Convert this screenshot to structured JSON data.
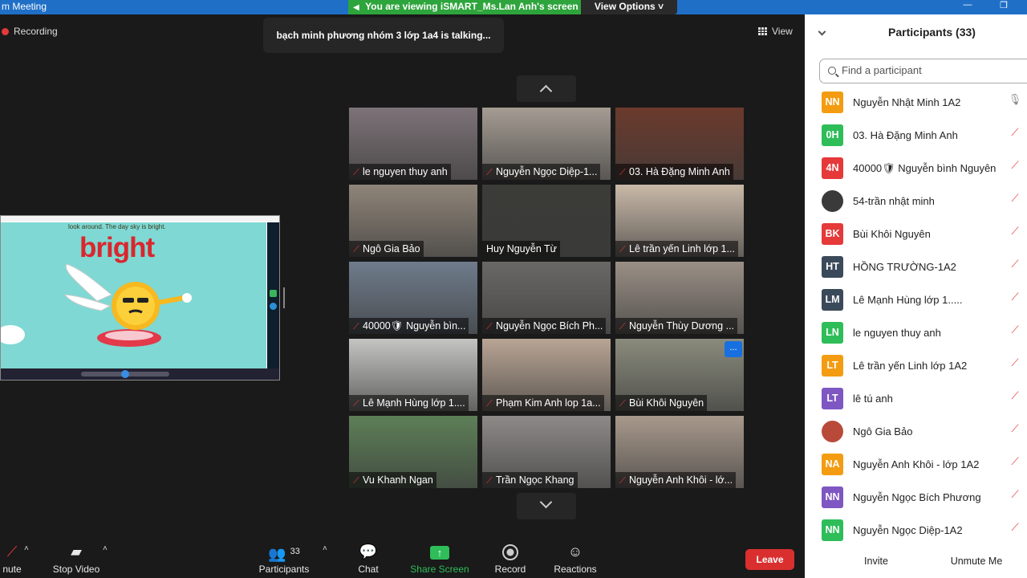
{
  "titlebar": {
    "title": "m Meeting",
    "viewing": "You are viewing iSMART_Ms.Lan Anh's screen",
    "view_options": "View Options"
  },
  "main": {
    "recording": "Recording",
    "talking": "bạch minh phương  nhóm 3 lớp 1a4 is talking...",
    "view_label": "View"
  },
  "share": {
    "caption": "look around. The day sky is bright.",
    "word": "bright"
  },
  "tiles": [
    {
      "name": "le nguyen thuy anh",
      "muted": true,
      "bg": "#7d7378"
    },
    {
      "name": "Nguyễn Ngọc Diệp-1...",
      "muted": true,
      "bg": "#a59c93"
    },
    {
      "name": "03. Hà Đặng Minh Anh",
      "muted": true,
      "bg": "#6b3a2c"
    },
    {
      "name": "Ngô Gia Bảo",
      "muted": true,
      "bg": "#8f8579"
    },
    {
      "name": "Huy Nguyễn Từ",
      "muted": false,
      "bg": "#3b3b38"
    },
    {
      "name": "Lê trần yến Linh lớp 1...",
      "muted": true,
      "bg": "#c9b9a8"
    },
    {
      "name": "40000🛡 Nguyễn bìn...",
      "muted": true,
      "bg": "#6f7c8c"
    },
    {
      "name": "Nguyễn Ngọc Bích Ph...",
      "muted": true,
      "bg": "#6a6866"
    },
    {
      "name": "Nguyễn Thùy Dương ...",
      "muted": true,
      "bg": "#9a8f85"
    },
    {
      "name": "Lê Mạnh Hùng lớp 1....",
      "muted": true,
      "bg": "#c4c4c2"
    },
    {
      "name": "Phạm Kim Anh lop 1a...",
      "muted": true,
      "bg": "#b9a594"
    },
    {
      "name": "Bùi Khôi Nguyên",
      "muted": true,
      "bg": "#8a8b7c",
      "more": "..."
    },
    {
      "name": "Vu Khanh Ngan",
      "muted": true,
      "bg": "#5d7f57"
    },
    {
      "name": "Trần Ngọc Khang",
      "muted": true,
      "bg": "#8d8a88"
    },
    {
      "name": "Nguyễn Anh Khôi - lớ...",
      "muted": true,
      "bg": "#a8998c"
    }
  ],
  "toolbar": {
    "unmute": "nute",
    "stop_video": "Stop Video",
    "participants": "Participants",
    "participants_count": "33",
    "chat": "Chat",
    "share_screen": "Share Screen",
    "record": "Record",
    "reactions": "Reactions",
    "leave": "Leave"
  },
  "panel": {
    "title": "Participants (33)",
    "search_placeholder": "Find a participant",
    "invite": "Invite",
    "unmute_me": "Unmute Me",
    "participants": [
      {
        "initials": "NN",
        "name": "Nguyễn Nhật Minh 1A2",
        "color": "#f39c12",
        "mic": "on"
      },
      {
        "initials": "0H",
        "name": "03. Hà Đặng Minh Anh",
        "color": "#2ebd59",
        "mic": "muted"
      },
      {
        "initials": "4N",
        "name": "40000🛡 Nguyễn bình Nguyên",
        "color": "#e5393a",
        "mic": "muted"
      },
      {
        "initials": "",
        "name": "54-trần nhật minh",
        "color": "#3a3a3a",
        "mic": "muted"
      },
      {
        "initials": "BK",
        "name": "Bùi Khôi Nguyên",
        "color": "#e5393a",
        "mic": "muted"
      },
      {
        "initials": "HT",
        "name": "HỒNG TRƯỜNG-1A2",
        "color": "#3b4a5a",
        "mic": "muted"
      },
      {
        "initials": "LM",
        "name": "Lê Mạnh Hùng lớp 1.....",
        "color": "#3b4a5a",
        "mic": "muted"
      },
      {
        "initials": "LN",
        "name": "le nguyen thuy anh",
        "color": "#2ebd59",
        "mic": "muted"
      },
      {
        "initials": "LT",
        "name": "Lê trần yến Linh lớp 1A2",
        "color": "#f39c12",
        "mic": "muted"
      },
      {
        "initials": "LT",
        "name": "lê tú anh",
        "color": "#7e57c2",
        "mic": "muted"
      },
      {
        "initials": "",
        "name": "Ngô Gia Bảo",
        "color": "#b94a3a",
        "mic": "muted"
      },
      {
        "initials": "NA",
        "name": "Nguyễn Anh Khôi - lớp 1A2",
        "color": "#f39c12",
        "mic": "muted"
      },
      {
        "initials": "NN",
        "name": "Nguyễn Ngọc Bích Phương",
        "color": "#7e57c2",
        "mic": "muted"
      },
      {
        "initials": "NN",
        "name": "Nguyễn Ngọc Diệp-1A2",
        "color": "#2ebd59",
        "mic": "muted"
      }
    ]
  }
}
